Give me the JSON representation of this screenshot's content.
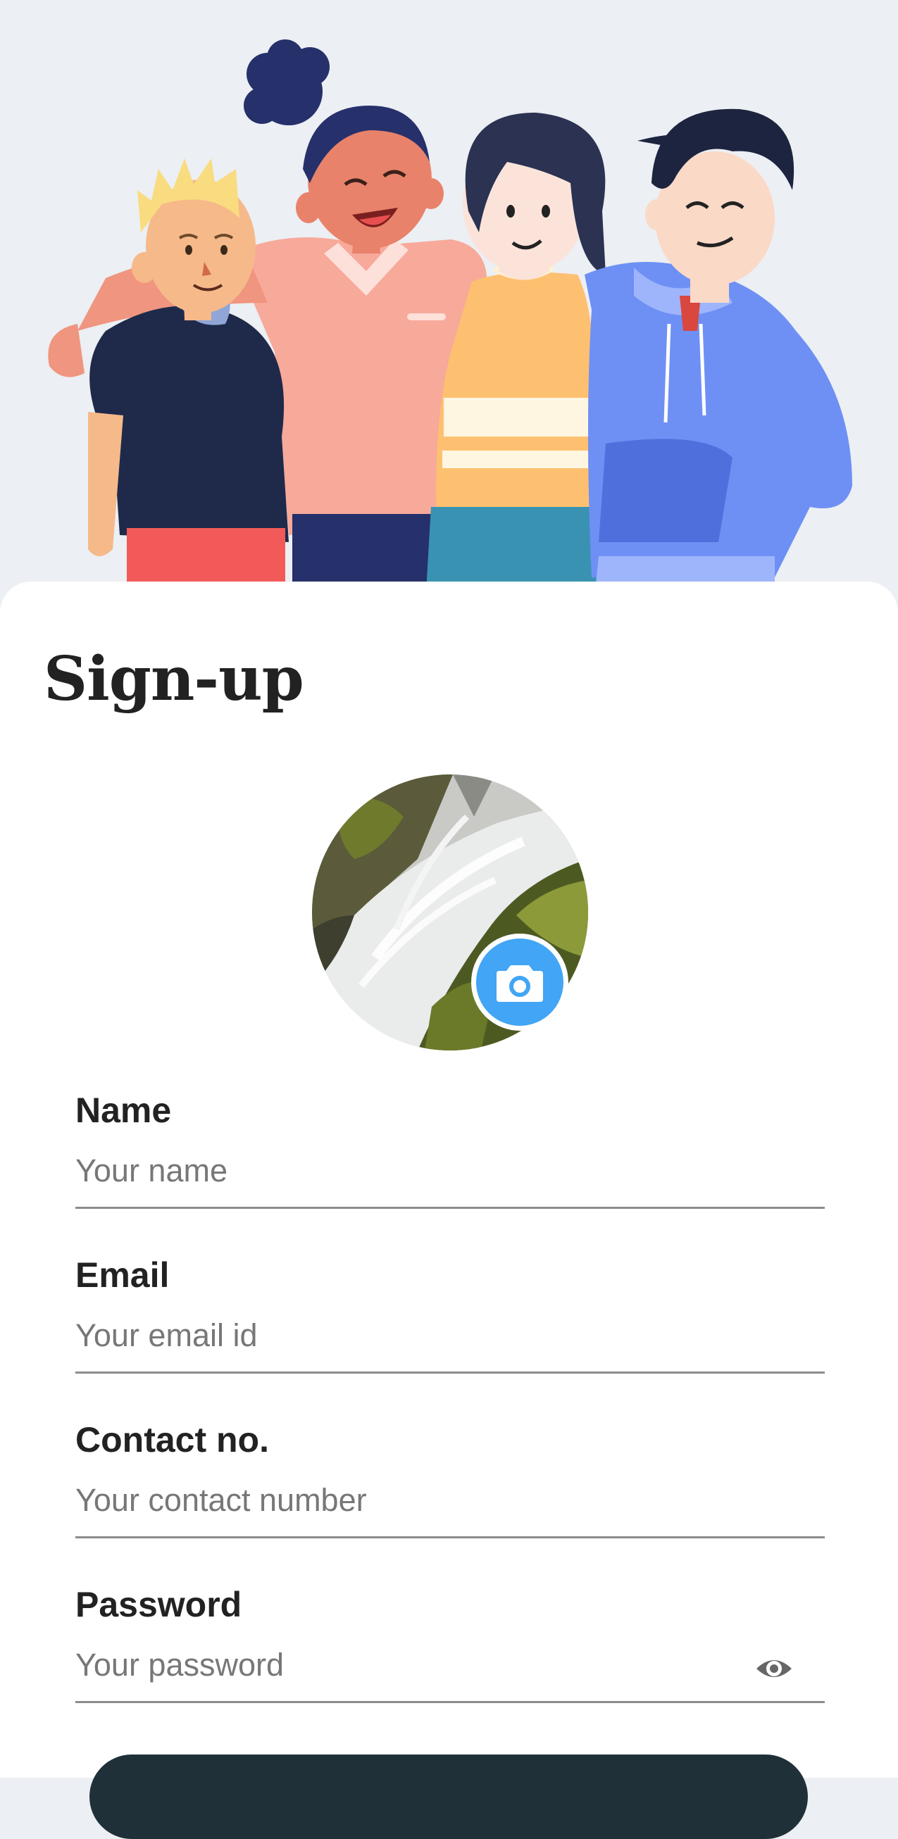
{
  "hero": {
    "illustration": "group-of-four-friends-illustration"
  },
  "form": {
    "title": "Sign-up",
    "avatar": {
      "image": "waterfall-photo",
      "camera_icon": "camera-icon"
    },
    "fields": [
      {
        "label": "Name",
        "placeholder": "Your name",
        "value": ""
      },
      {
        "label": "Email",
        "placeholder": "Your email id",
        "value": ""
      },
      {
        "label": "Contact no.",
        "placeholder": "Your contact number",
        "value": ""
      },
      {
        "label": "Password",
        "placeholder": "Your password",
        "value": "",
        "toggle_icon": "eye-icon"
      }
    ],
    "submit_label": ""
  },
  "colors": {
    "accent": "#42a5f5",
    "button": "#1f3038",
    "text": "#222222",
    "placeholder": "#777777",
    "background": "#eceff3"
  }
}
